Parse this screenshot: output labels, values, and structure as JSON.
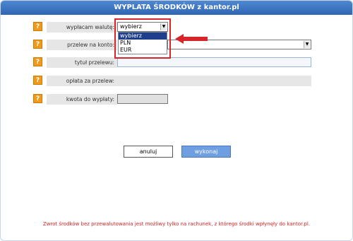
{
  "window": {
    "title": "WYPLATA ŚRODKÓW z kantor.pl"
  },
  "help_icon": "?",
  "form": {
    "rows": [
      {
        "label": "wypłacam walutę:"
      },
      {
        "label": "przelew na konto:"
      },
      {
        "label": "tytuł przelewu:"
      },
      {
        "label": "opłata za przelew:"
      },
      {
        "label": "kwota do wypłaty:"
      }
    ],
    "currency_select": {
      "value": "wybierz",
      "options": [
        "wybierz",
        "PLN",
        "EUR"
      ],
      "selected_index": 0
    },
    "account_select": {
      "value": ""
    },
    "transfer_title": {
      "value": ""
    },
    "amount": {
      "value": ""
    }
  },
  "buttons": {
    "cancel": "anuluj",
    "submit": "wykonaj"
  },
  "footnote": "Zwrot środków bez przewalutowania jest możliwy tylko na rachunek, z którego środki wpłynęły do kantor.pl.",
  "colors": {
    "title_bg": "#2f66b5",
    "help_badge": "#f09a1c",
    "highlight": "#d8252a",
    "footnote": "#e02020"
  },
  "icons": {
    "help": "question-icon",
    "dropdown": "chevron-down-icon",
    "annotation": "arrow-left-icon"
  }
}
